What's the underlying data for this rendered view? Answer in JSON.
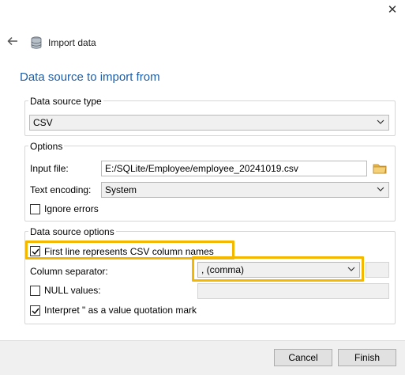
{
  "window": {
    "close_symbol": "✕"
  },
  "header": {
    "back_symbol": "🡐",
    "title": "Import data"
  },
  "section_title": "Data source to import from",
  "data_source_type": {
    "legend": "Data source type",
    "selected": "CSV"
  },
  "options": {
    "legend": "Options",
    "input_file_label": "Input file:",
    "input_file_value": "E:/SQLite/Employee/employee_20241019.csv",
    "text_encoding_label": "Text encoding:",
    "text_encoding_value": "System",
    "ignore_errors_label": "Ignore errors",
    "ignore_errors_checked": false
  },
  "data_source_options": {
    "legend": "Data source options",
    "first_line_label": "First line represents CSV column names",
    "first_line_checked": true,
    "column_separator_label": "Column separator:",
    "column_separator_value": ", (comma)",
    "null_values_label": "NULL values:",
    "null_values_checked": false,
    "interpret_quote_label": "Interpret \" as a value quotation mark",
    "interpret_quote_checked": true
  },
  "footer": {
    "cancel_label": "Cancel",
    "finish_label": "Finish"
  },
  "colors": {
    "highlight": "#f5b800",
    "title_blue": "#1f5ea8"
  },
  "icons": [
    "close-icon",
    "back-arrow-icon",
    "database-icon",
    "chevron-down-icon",
    "folder-icon",
    "checkmark-icon"
  ]
}
